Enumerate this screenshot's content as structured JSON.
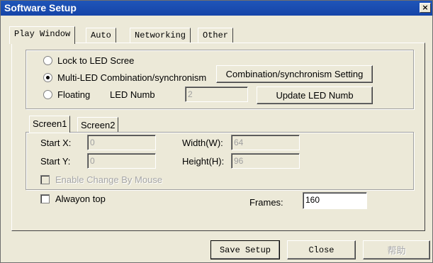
{
  "window": {
    "title": "Software Setup",
    "close_glyph": "×"
  },
  "tabs": [
    {
      "label": "Play Window",
      "active": true
    },
    {
      "label": "Auto",
      "active": false
    },
    {
      "label": "Networking",
      "active": false
    },
    {
      "label": "Other",
      "active": false
    }
  ],
  "mode": {
    "options": [
      {
        "label": "Lock to LED Scree",
        "checked": false
      },
      {
        "label": "Multi-LED Combination/synchronism",
        "checked": true
      },
      {
        "label": "Floating",
        "checked": false
      }
    ],
    "combination_button": "Combination/synchronism Setting",
    "led_numb_label": "LED Numb",
    "led_numb_value": "2",
    "update_button": "Update LED Numb"
  },
  "screen": {
    "tabs": [
      "Screen1",
      "Screen2"
    ],
    "start_x_label": "Start X:",
    "start_x_value": "0",
    "start_y_label": "Start Y:",
    "start_y_value": "0",
    "width_label": "Width(W):",
    "width_value": "64",
    "height_label": "Height(H):",
    "height_value": "96",
    "enable_mouse_label": "Enable Change By Mouse"
  },
  "always_on_top_label": "Alwayon top",
  "frames_label": "Frames:",
  "frames_value": "160",
  "footer": {
    "save_label": "Save Setup",
    "close_label": "Close",
    "help_label": "帮助"
  }
}
